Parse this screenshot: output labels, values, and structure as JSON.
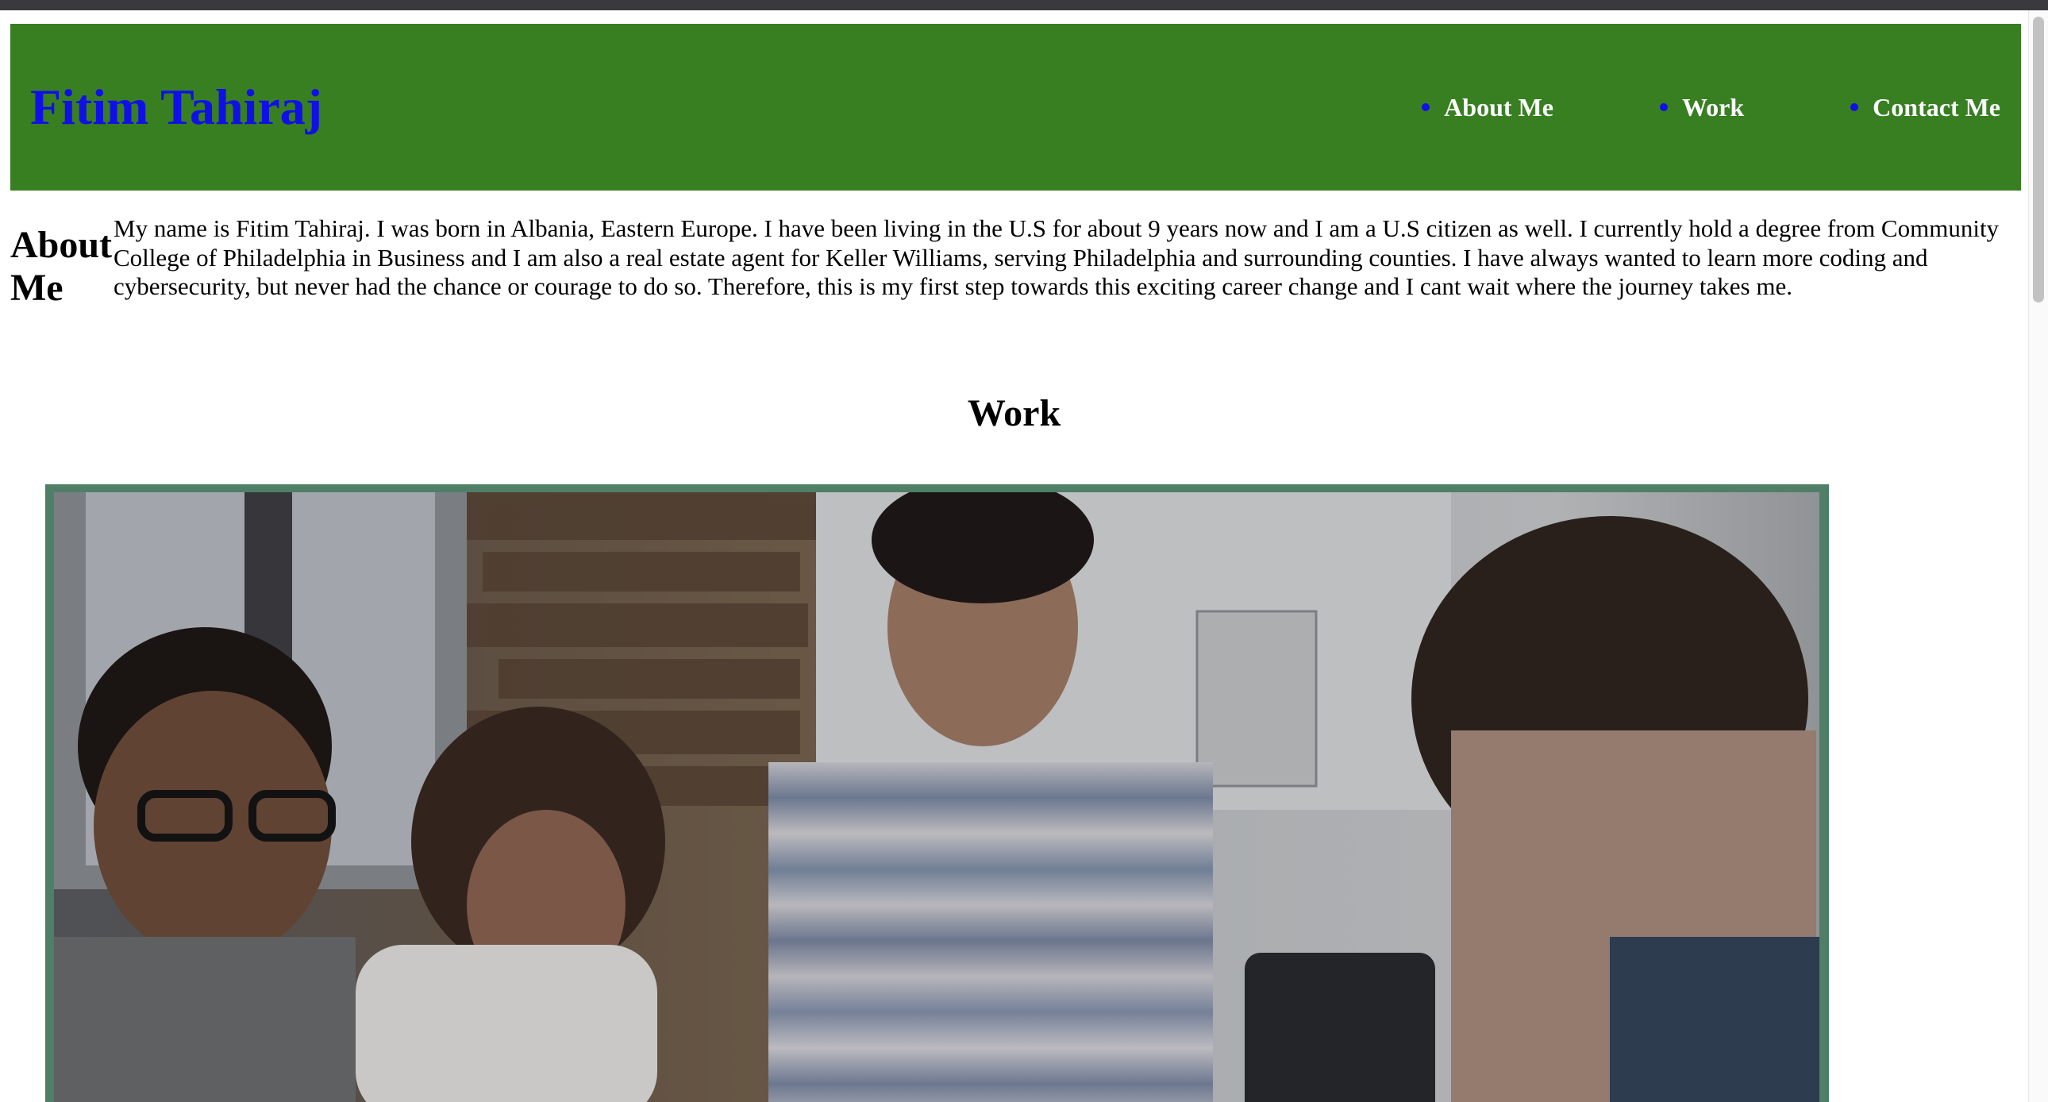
{
  "site": {
    "title": "Fitim Tahiraj"
  },
  "nav": {
    "items": [
      {
        "label": "About Me"
      },
      {
        "label": "Work"
      },
      {
        "label": "Contact Me"
      }
    ]
  },
  "about": {
    "heading": "About Me",
    "text": "My name is Fitim Tahiraj. I was born in Albania, Eastern Europe. I have been living in the U.S for about 9 years now and I am a U.S citizen as well. I currently hold a degree from Community College of Philadelphia in Business and I am also a real estate agent for Keller Williams, serving Philadelphia and surrounding counties. I have always wanted to learn more coding and cybersecurity, but never had the chance or courage to do so. Therefore, this is my first step towards this exciting career change and I cant wait where the journey takes me."
  },
  "work": {
    "heading": "Work"
  },
  "colors": {
    "header_bg": "#387f22",
    "title": "#1010e6",
    "nav_text": "#ffffff",
    "frame_border": "#4f7f67"
  }
}
